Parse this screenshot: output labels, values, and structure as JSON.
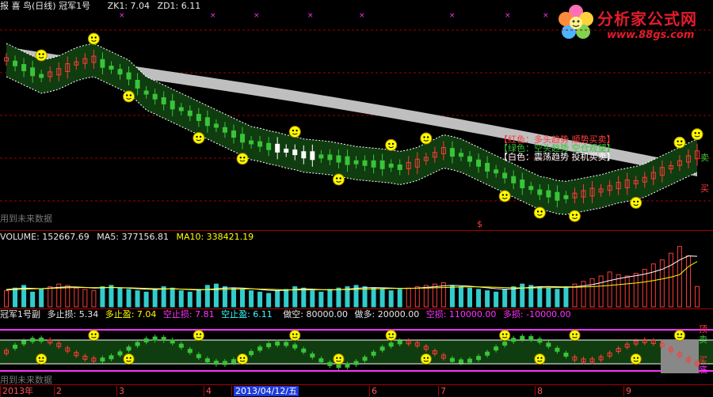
{
  "header": {
    "app_title": "报 喜 鸟(日线) 冠军1号",
    "zk1": "ZK1: 7.04",
    "zd1": "ZD1: 6.11"
  },
  "main_watermark": "用到未来数据",
  "sub_watermark": "用到未来数据",
  "logo": {
    "title": "分析家公式网",
    "url": "www.88gs.com"
  },
  "legend": {
    "red": "【红色：多头趋势 顺势买卖】",
    "green": "【绿色：空头趋势 空仓观望】",
    "white": "【白色：震荡趋势 投机买卖】"
  },
  "main_labels": {
    "sell": "卖",
    "buy": "买",
    "dollar": "$"
  },
  "volume_header": {
    "volume": "VOLUME: 152667.69",
    "ma5": "MA5: 377156.81",
    "ma10": "MA10: 338421.19"
  },
  "sub_header": {
    "name": "冠军1号副",
    "duo_zhisun": "多止损: 5.34",
    "duo_zhiying": "多止盈: 7.04",
    "kong_zhisun": "空止损: 7.81",
    "kong_zhiying": "空止盈: 6.11",
    "zuo_kong": "做空: 80000.00",
    "zuo_duo": "做多: 20000.00",
    "kong_sun": "空损: 110000.00",
    "duo_sun": "多损: -10000.00"
  },
  "sub_labels": {
    "ding": "顶",
    "mai": "卖",
    "mai2": "买",
    "di": "底"
  },
  "axis": {
    "labels": [
      {
        "text": "2013年"
      },
      {
        "text": "2"
      },
      {
        "text": "3"
      },
      {
        "text": "4"
      },
      {
        "text": "2013/04/12/五",
        "highlight": true
      },
      {
        "text": "6"
      },
      {
        "text": "7"
      },
      {
        "text": "8"
      },
      {
        "text": "9"
      }
    ]
  },
  "colors": {
    "up": "#ff3b3b",
    "down": "#39c439",
    "neutral": "#ffffff",
    "band_fill": "#0f3d0f",
    "band_edge": "#ffffff",
    "ma_band": "#bfbfbf",
    "magenta": "#ff33ff",
    "yellow": "#ffff00",
    "cyan": "#33ffff",
    "volume_up": "#ff3b3b",
    "volume_down": "#33cccc",
    "ma5_line": "#ffffff",
    "ma10_line": "#ffff00",
    "grid_red": "#a00000"
  },
  "chart_data": {
    "type": "candlestick",
    "title": "报 喜 鸟(日线) 冠军1号",
    "xlabel": "",
    "ylabel": "",
    "series": [
      {
        "name": "Price",
        "values": [
          7.0,
          6.95,
          6.9,
          6.85,
          6.8,
          6.82,
          6.85,
          6.9,
          6.95,
          6.98,
          7.0,
          6.95,
          6.9,
          6.85,
          6.8,
          6.7,
          6.6,
          6.55,
          6.5,
          6.45,
          6.4,
          6.35,
          6.3,
          6.25,
          6.2,
          6.15,
          6.1,
          6.05,
          6.0,
          5.98,
          5.95,
          5.93,
          5.9,
          5.88,
          5.85,
          5.84,
          5.83,
          5.82,
          5.8,
          5.78,
          5.76,
          5.75,
          5.74,
          5.73,
          5.72,
          5.7,
          5.72,
          5.75,
          5.8,
          5.85,
          5.9,
          5.88,
          5.85,
          5.8,
          5.75,
          5.7,
          5.65,
          5.6,
          5.55,
          5.5,
          5.45,
          5.4,
          5.38,
          5.35,
          5.34,
          5.36,
          5.38,
          5.4,
          5.42,
          5.45,
          5.48,
          5.5,
          5.52,
          5.55,
          5.6,
          5.65,
          5.7,
          5.75,
          5.8,
          5.85
        ]
      },
      {
        "name": "VOLUME",
        "values": [
          120,
          140,
          160,
          110,
          130,
          150,
          170,
          160,
          140,
          130,
          120,
          150,
          160,
          140,
          130,
          120,
          110,
          130,
          150,
          140,
          120,
          110,
          130,
          160,
          170,
          150,
          140,
          130,
          120,
          110,
          100,
          120,
          130,
          150,
          140,
          120,
          110,
          130,
          140,
          150,
          160,
          150,
          140,
          130,
          120,
          130,
          140,
          150,
          160,
          170,
          180,
          160,
          150,
          140,
          130,
          120,
          110,
          130,
          150,
          170,
          160,
          150,
          140,
          130,
          150,
          170,
          190,
          210,
          230,
          260,
          240,
          230,
          250,
          280,
          320,
          350,
          400,
          450,
          380,
          152
        ]
      },
      {
        "name": "MA5",
        "values": [
          130,
          135,
          140,
          138,
          136,
          140,
          145,
          150,
          148,
          145,
          140,
          142,
          145,
          143,
          140,
          135,
          132,
          130,
          133,
          136,
          132,
          128,
          126,
          130,
          135,
          140,
          142,
          140,
          136,
          130,
          124,
          122,
          124,
          130,
          134,
          132,
          128,
          126,
          128,
          132,
          138,
          142,
          144,
          142,
          140,
          138,
          138,
          140,
          145,
          150,
          156,
          160,
          158,
          154,
          148,
          142,
          136,
          132,
          134,
          140,
          146,
          150,
          152,
          150,
          148,
          150,
          156,
          166,
          180,
          196,
          210,
          222,
          232,
          244,
          260,
          280,
          310,
          350,
          380,
          377
        ]
      },
      {
        "name": "MA10",
        "values": [
          125,
          128,
          132,
          134,
          136,
          138,
          140,
          142,
          144,
          144,
          144,
          144,
          144,
          143,
          142,
          140,
          138,
          136,
          135,
          134,
          133,
          131,
          129,
          128,
          128,
          130,
          132,
          134,
          134,
          133,
          131,
          129,
          127,
          126,
          126,
          127,
          128,
          128,
          128,
          129,
          130,
          132,
          134,
          136,
          137,
          138,
          138,
          139,
          140,
          142,
          144,
          146,
          148,
          149,
          149,
          148,
          146,
          144,
          142,
          141,
          141,
          142,
          143,
          144,
          145,
          146,
          148,
          151,
          155,
          160,
          166,
          172,
          178,
          186,
          196,
          208,
          222,
          240,
          300,
          338
        ]
      }
    ]
  }
}
